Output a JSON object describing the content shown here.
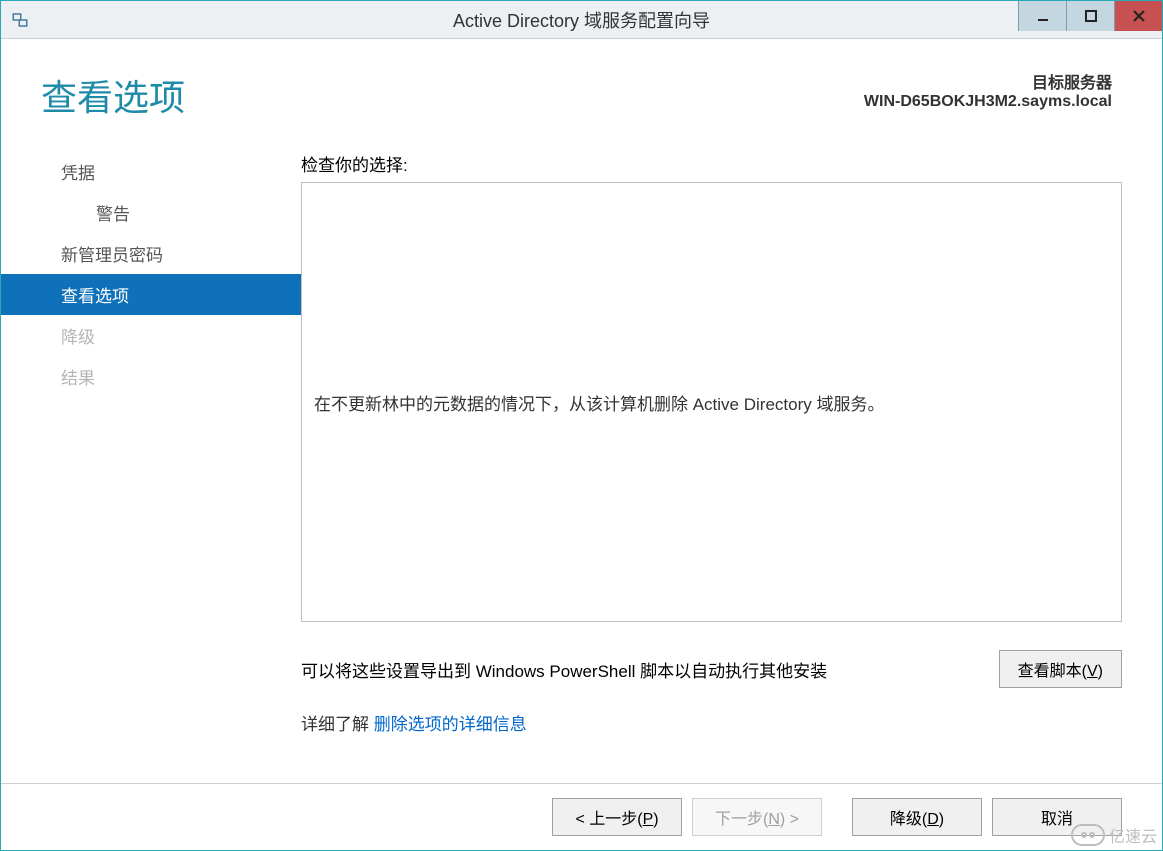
{
  "window": {
    "title": "Active Directory 域服务配置向导"
  },
  "header": {
    "page_title": "查看选项",
    "target_label": "目标服务器",
    "target_server": "WIN-D65BOKJH3M2.sayms.local"
  },
  "sidebar": {
    "items": [
      {
        "label": "凭据",
        "state": "normal",
        "indent": false
      },
      {
        "label": "警告",
        "state": "normal",
        "indent": true
      },
      {
        "label": "新管理员密码",
        "state": "normal",
        "indent": false
      },
      {
        "label": "查看选项",
        "state": "active",
        "indent": false
      },
      {
        "label": "降级",
        "state": "disabled",
        "indent": false
      },
      {
        "label": "结果",
        "state": "disabled",
        "indent": false
      }
    ]
  },
  "main": {
    "review_label": "检查你的选择:",
    "review_text": "在不更新林中的元数据的情况下，从该计算机删除 Active Directory 域服务。",
    "export_text": "可以将这些设置导出到 Windows PowerShell 脚本以自动执行其他安装",
    "view_script_btn": "查看脚本(V)",
    "view_script_hotkey": "V",
    "link_pre": "详细了解 ",
    "link_text": "删除选项的详细信息"
  },
  "footer": {
    "prev": "< 上一步(P)",
    "prev_hotkey": "P",
    "next": "下一步(N) >",
    "next_hotkey": "N",
    "demote": "降级(D)",
    "demote_hotkey": "D",
    "cancel": "取消"
  },
  "watermark": "亿速云"
}
